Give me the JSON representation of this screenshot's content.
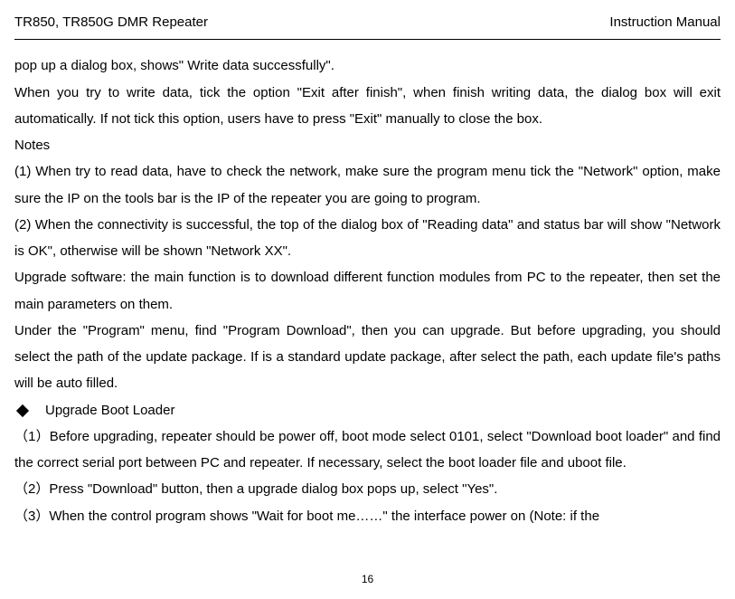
{
  "header": {
    "left": "TR850, TR850G DMR Repeater",
    "right": "Instruction Manual"
  },
  "content": {
    "p1": "pop up a dialog box, shows\" Write data successfully\".",
    "p2": "When you try to write data, tick the option \"Exit after finish\", when finish writing data, the dialog box will exit automatically. If not tick this option, users have to press \"Exit\" manually to close the box.",
    "p3": "Notes",
    "p4": "(1) When try to read data, have to check the network, make sure the program menu tick the \"Network\" option, make sure the IP on the tools bar is the IP of the repeater you are going to program.",
    "p5": "(2) When the connectivity is successful, the top of the dialog box of \"Reading data\" and status bar will show \"Network is OK\", otherwise will be shown \"Network XX\".",
    "p6": "Upgrade software: the main function is to download different function modules from PC to the repeater, then set the main parameters on them.",
    "p7": "Under the \"Program\" menu, find \"Program Download\", then you can upgrade. But before upgrading, you should select the path of the update package. If is a standard update package, after select the path, each update file's paths will be auto filled.",
    "bullet1": "Upgrade Boot Loader",
    "p8": "（1）Before upgrading, repeater should be power off, boot mode select 0101, select \"Download boot loader\" and find the correct serial port between PC and repeater. If necessary, select the boot loader file and uboot file.",
    "p9": "（2）Press \"Download\" button, then a upgrade dialog box pops up, select \"Yes\".",
    "p10": "（3）When the control program shows \"Wait for boot me……\" the interface power on (Note: if the"
  },
  "footer": {
    "page_number": "16"
  }
}
